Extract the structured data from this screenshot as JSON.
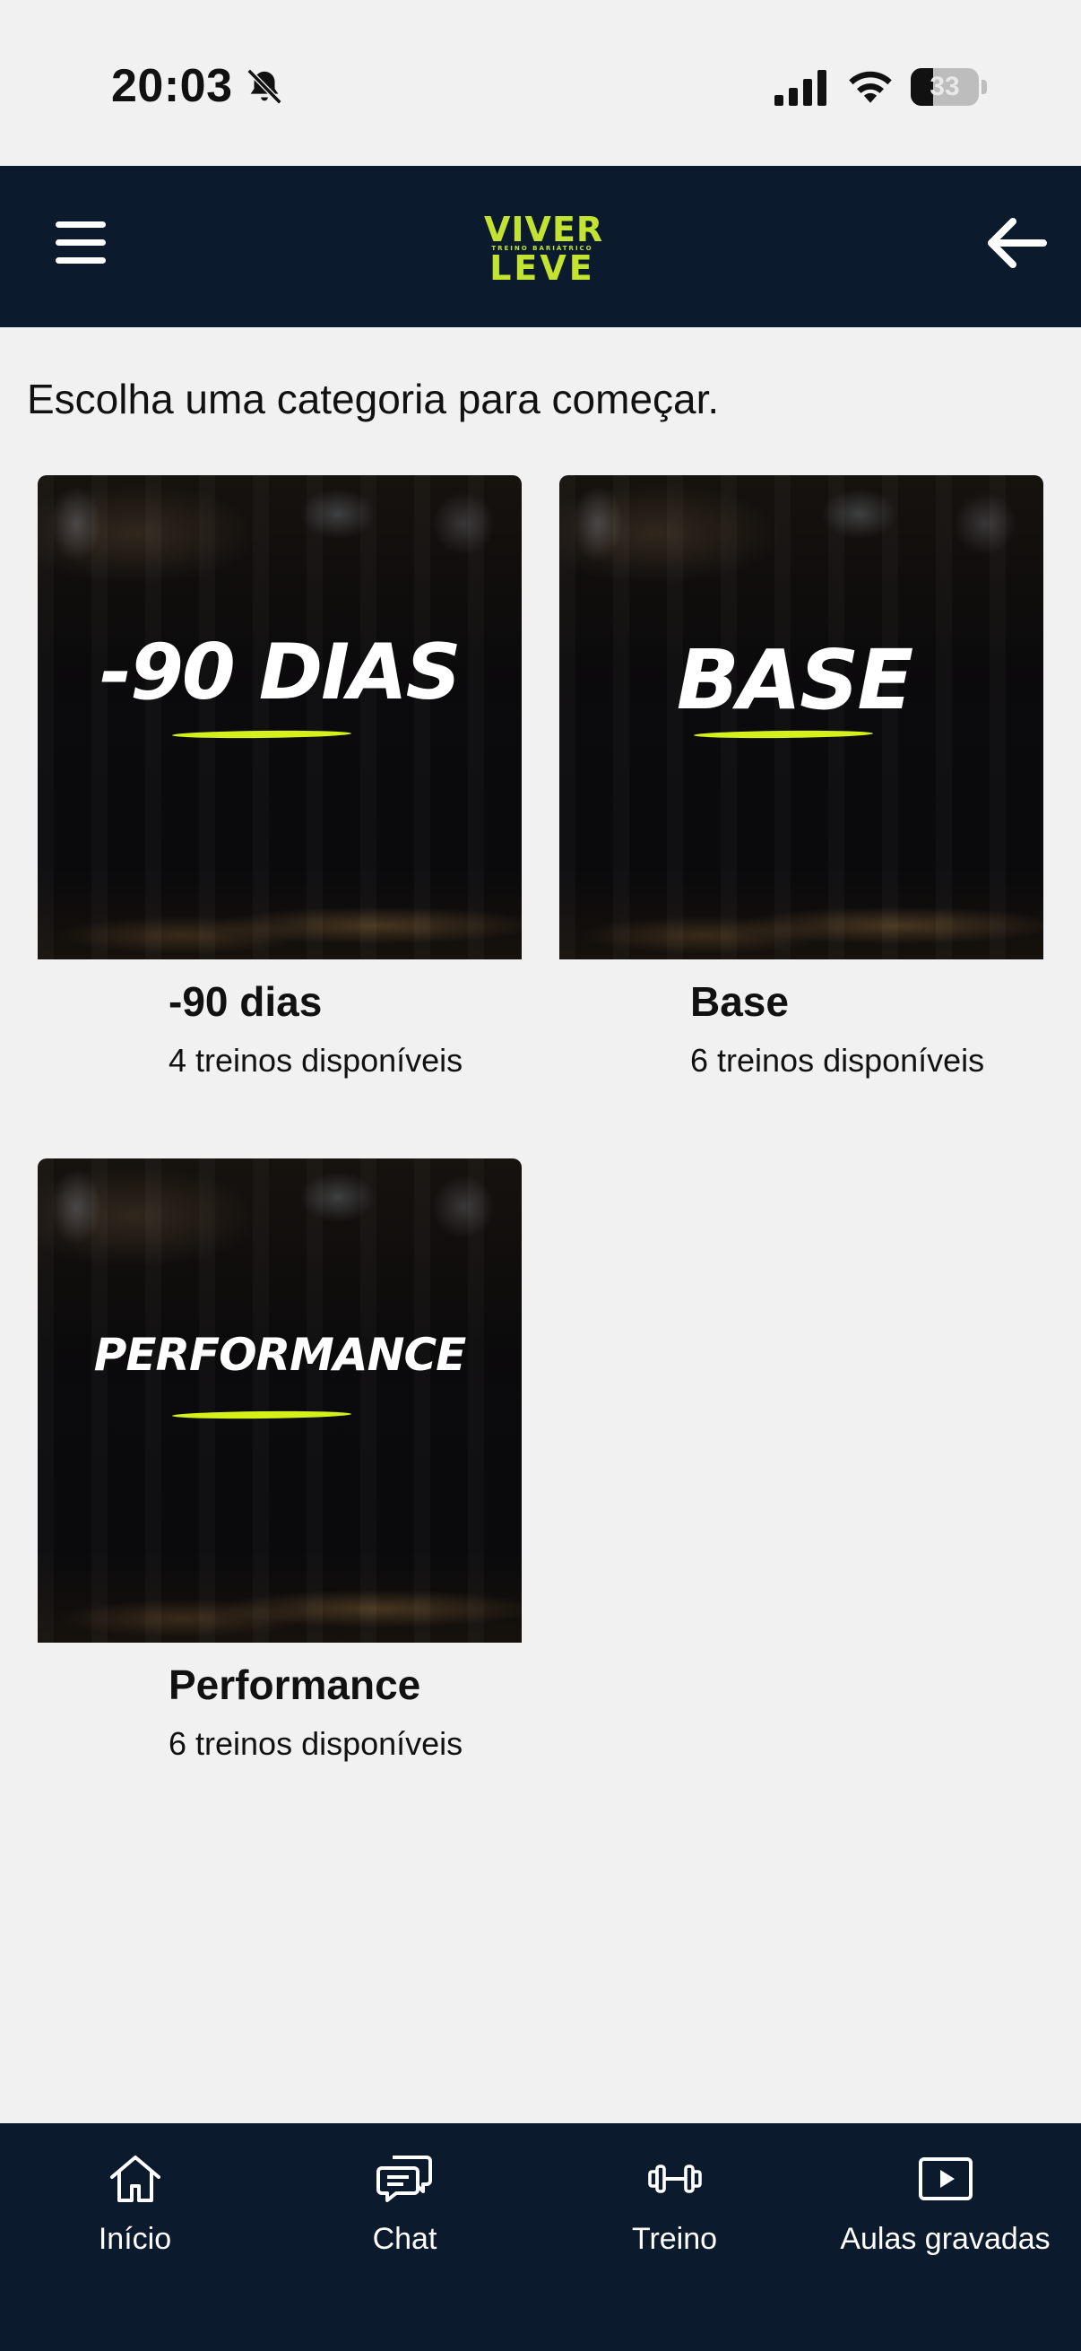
{
  "status_bar": {
    "time": "20:03",
    "battery_level": 33,
    "battery_label": "33"
  },
  "header": {
    "logo_line1": "VIVER",
    "logo_subtitle": "TREINO BARIÁTRICO",
    "logo_line2": "LEVE"
  },
  "main": {
    "intro": "Escolha uma categoria para começar.",
    "categories": [
      {
        "art_text": "-90 DIAS",
        "title": "-90 dias",
        "subtitle": "4 treinos disponíveis"
      },
      {
        "art_text": "BASE",
        "title": "Base",
        "subtitle": "6 treinos disponíveis"
      },
      {
        "art_text": "PERFORMANCE",
        "title": "Performance",
        "subtitle": "6 treinos disponíveis"
      }
    ]
  },
  "bottom_nav": {
    "items": [
      {
        "label": "Início",
        "icon": "home-icon"
      },
      {
        "label": "Chat",
        "icon": "chat-icon"
      },
      {
        "label": "Treino",
        "icon": "dumbbell-icon"
      },
      {
        "label": "Aulas gravadas",
        "icon": "play-icon"
      }
    ]
  },
  "colors": {
    "header_bg": "#0c1a2d",
    "accent": "#c2e330",
    "page_bg": "#f1f1f1"
  }
}
